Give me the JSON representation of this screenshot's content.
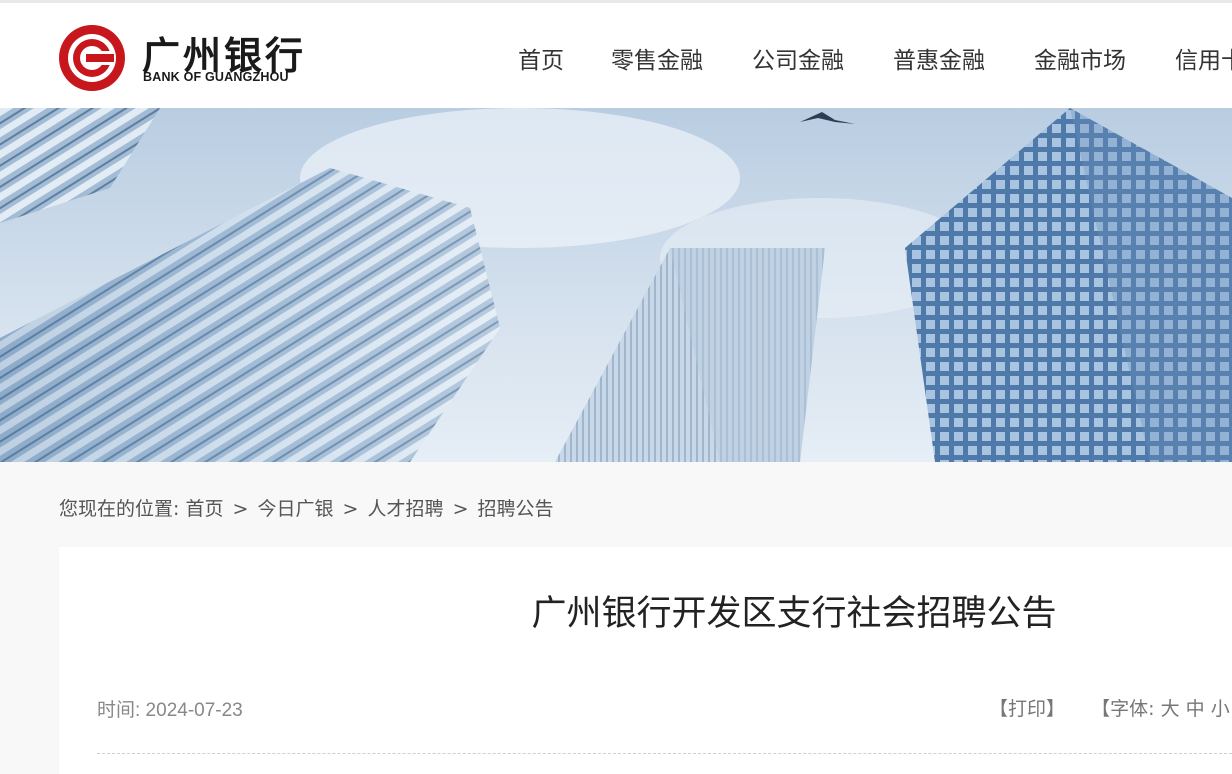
{
  "brand": {
    "name_cn": "广州银行",
    "name_en": "BANK OF GUANGZHOU",
    "accent": "#c8161d"
  },
  "nav": {
    "items": [
      {
        "label": "首页"
      },
      {
        "label": "零售金融"
      },
      {
        "label": "公司金融"
      },
      {
        "label": "普惠金融"
      },
      {
        "label": "金融市场"
      },
      {
        "label": "信用卡"
      }
    ]
  },
  "breadcrumb": {
    "prefix": "您现在的位置:",
    "items": [
      "首页",
      "今日广银",
      "人才招聘",
      "招聘公告"
    ],
    "separator": ">"
  },
  "article": {
    "title": "广州银行开发区支行社会招聘公告",
    "date_label": "时间: 2024-07-23",
    "print_label": "【打印】",
    "font_label": "【字体:",
    "font_large": "大",
    "font_medium": "中",
    "font_small": "小"
  }
}
